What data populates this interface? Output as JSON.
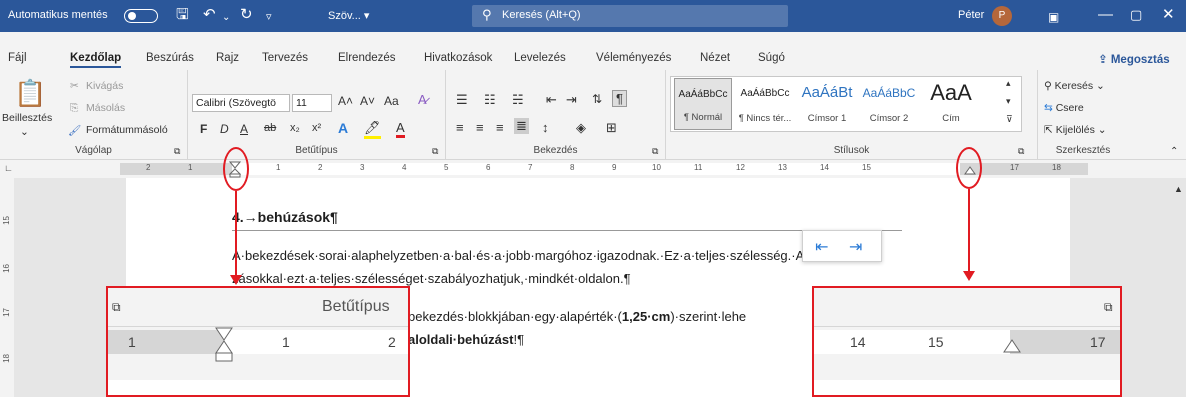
{
  "titlebar": {
    "autosave_label": "Automatikus mentés",
    "doc_name": "Szöv... ▾",
    "search_placeholder": "Keresés (Alt+Q)",
    "user_name": "Péter",
    "user_initial": "P"
  },
  "menu": {
    "items": [
      "Fájl",
      "Kezdőlap",
      "Beszúrás",
      "Rajz",
      "Tervezés",
      "Elrendezés",
      "Hivatkozások",
      "Levelezés",
      "Véleményezés",
      "Nézet",
      "Súgó"
    ],
    "share": "Megosztás"
  },
  "ribbon": {
    "clipboard": {
      "paste": "Beillesztés",
      "cut": "Kivágás",
      "copy": "Másolás",
      "format_painter": "Formátummásoló",
      "label": "Vágólap"
    },
    "font": {
      "font_name": "Calibri (Szövegtö",
      "font_size": "11",
      "label": "Betűtípus",
      "grow": "A˄",
      "shrink": "A˅",
      "case": "Aa",
      "bold": "F",
      "italic": "D",
      "underline": "A",
      "strike": "ab",
      "sub": "x₂",
      "sup": "x²"
    },
    "paragraph": {
      "label": "Bekezdés"
    },
    "styles": {
      "label": "Stílusok",
      "items": [
        {
          "preview": "AaÁáBbCc",
          "name": "¶ Normál"
        },
        {
          "preview": "AaÁáBbCc",
          "name": "¶ Nincs tér..."
        },
        {
          "preview": "AaÁáBt",
          "name": "Címsor 1"
        },
        {
          "preview": "AaÁáBbC",
          "name": "Címsor 2"
        },
        {
          "preview": "AaA",
          "name": "Cím"
        }
      ]
    },
    "editing": {
      "find": "Keresés",
      "replace": "Csere",
      "select": "Kijelölés",
      "label": "Szerkesztés"
    }
  },
  "ruler": {
    "left_numbers": [
      "2",
      "1"
    ],
    "right_numbers": [
      "1",
      "2",
      "3",
      "4",
      "5",
      "6",
      "7",
      "8",
      "9",
      "10",
      "11",
      "12",
      "13",
      "14",
      "15",
      "17",
      "18"
    ]
  },
  "vruler": [
    "15",
    "16",
    "17",
    "18"
  ],
  "document": {
    "heading": "4.→behúzások¶",
    "para1_line1": "A·bekezdések·sorai·alaphelyzetben·a·bal·és·a·jobb·margóhoz·igazodnak.·Ez·a·teljes·szélesség.·A·behú-",
    "para1_line2": "zásokkal·ezt·a·teljes·szélességet·szabályozhatjuk,·mindkét·oldalon.¶",
    "para2_part": "bekezdés·blokkjában·egy·alapérték·(",
    "para2_bold": "1,25·cm",
    "para2_end": ")·szerint·lehe",
    "para3_bold": "aloldali·behúzást",
    "para3_end": "!¶"
  },
  "zoom_left": {
    "title": "Betűtípus",
    "numbers": [
      "1",
      "1",
      "2"
    ]
  },
  "zoom_right": {
    "numbers": [
      "14",
      "15",
      "17"
    ]
  }
}
